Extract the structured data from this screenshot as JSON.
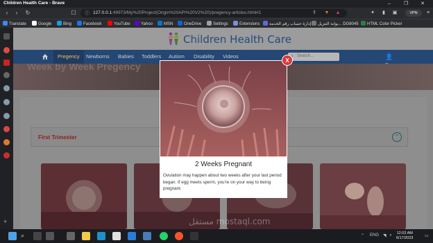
{
  "window": {
    "title": "Children Health Care - Brave"
  },
  "browser": {
    "url_host": "127.0.0.1",
    "url_path": ":49973/My%20Project(Origin%20API%20V2%20)/pregency-articles.html#1",
    "vpn_label": "VPN",
    "bookmarks": [
      "Translate",
      "Google",
      "Bing",
      "Facebook",
      "YouTube",
      "Yahoo",
      "MSN",
      "OneDrive",
      "Settings",
      "Extensions",
      "إدارة حساب رقم الخدمة",
      "بوابة التنزيل... DG8045",
      "HTML Color Picker"
    ],
    "bookmark_colors": [
      "#4285f4",
      "#ffffff",
      "#1a9dd9",
      "#1877f2",
      "#ff0000",
      "#6001d2",
      "#0078d4",
      "#0a64d8",
      "#9aa0a6",
      "#7b8ed8",
      "#5b6bd6",
      "#777777",
      "#2d7d46"
    ]
  },
  "site": {
    "logo_text": "Children Health Care",
    "nav": [
      "Pregency",
      "Newborns",
      "Babies",
      "Toddlers",
      "Autism",
      "Disability",
      "Videos"
    ],
    "active_nav": "Pregency",
    "search_placeholder": "Search...",
    "hero_text": "Week by Week Pregency",
    "section_title": "First Trimester",
    "toggle_icon": "chevron-up-icon"
  },
  "modal": {
    "title": "2 Weeks Pregnant",
    "text": "Ovulation may happen about two weeks after your last period began. If egg meets sperm, you're on your way to being pregnant.",
    "close_label": "X"
  },
  "taskbar": {
    "time": "12:02 AM",
    "date": "6/17/2023",
    "language": "ENG",
    "watermark": "مستقل mostaql.com"
  },
  "colors": {
    "nav_bg": "#244774",
    "active_nav_text": "#f0c060",
    "logo": "#234a7e",
    "section_title": "#8b2020",
    "close_button": "#d93a3a"
  }
}
